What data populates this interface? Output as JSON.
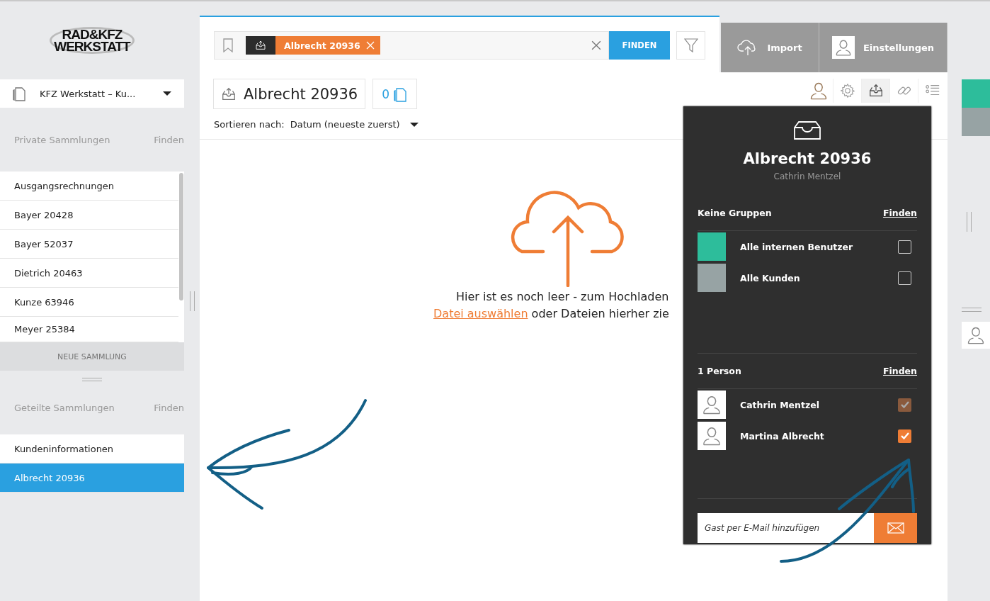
{
  "logo": {
    "line1": "RAD&KFZ",
    "line2": "WERKSTATT"
  },
  "workspace": {
    "label": "KFZ Werkstatt – Ku..."
  },
  "private": {
    "title": "Private Sammlungen",
    "find": "Finden",
    "items": [
      {
        "label": "Ausgangsrechnungen",
        "selected": false
      },
      {
        "label": "Bayer 20428",
        "selected": false
      },
      {
        "label": "Bayer 52037",
        "selected": false
      },
      {
        "label": "Dietrich 20463",
        "selected": false
      },
      {
        "label": "Kunze 63946",
        "selected": false
      },
      {
        "label": "Meyer 25384",
        "selected": false
      }
    ],
    "new_button": "NEUE SAMMLUNG"
  },
  "shared": {
    "title": "Geteilte Sammlungen",
    "find": "Finden",
    "items": [
      {
        "label": "Kundeninformationen",
        "selected": false
      },
      {
        "label": "Albrecht 20936",
        "selected": true
      }
    ]
  },
  "search": {
    "tag": "Albrecht 20936",
    "button": "FINDEN"
  },
  "collection": {
    "title": "Albrecht 20936",
    "count": "0"
  },
  "sort": {
    "label": "Sortieren nach:",
    "value": "Datum (neueste zuerst)"
  },
  "empty": {
    "line1": "Hier ist es noch leer - zum Hochladen",
    "link": "Datei auswählen",
    "line2": "oder Dateien hierher zie"
  },
  "top_buttons": [
    {
      "kind": "cloud",
      "label": "Import"
    },
    {
      "kind": "avatar",
      "label": "Einstellungen"
    }
  ],
  "toolbar": [
    {
      "kind": "user",
      "selected": false
    },
    {
      "kind": "gear",
      "selected": false
    },
    {
      "kind": "inbox",
      "selected": true
    },
    {
      "kind": "link",
      "selected": false
    },
    {
      "kind": "list",
      "selected": false
    }
  ],
  "popover": {
    "title": "Albrecht 20936",
    "owner": "Cathrin Mentzel",
    "groups_title": "Keine Gruppen",
    "groups_find": "Finden",
    "groups": [
      {
        "label": "Alle internen Benutzer",
        "color": "#2dbd9b",
        "checked": false
      },
      {
        "label": "Alle Kunden",
        "color": "#97a3a4",
        "checked": false
      }
    ],
    "persons_title": "1 Person",
    "persons_find": "Finden",
    "persons": [
      {
        "label": "Cathrin Mentzel",
        "checked": true,
        "disabled": true
      },
      {
        "label": "Martina Albrecht",
        "checked": true,
        "disabled": false
      }
    ],
    "email_placeholder": "Gast per E-Mail hinzufügen"
  },
  "right_strip": [
    {
      "color": "#2dbd9b"
    },
    {
      "color": "#97a3a4"
    }
  ]
}
